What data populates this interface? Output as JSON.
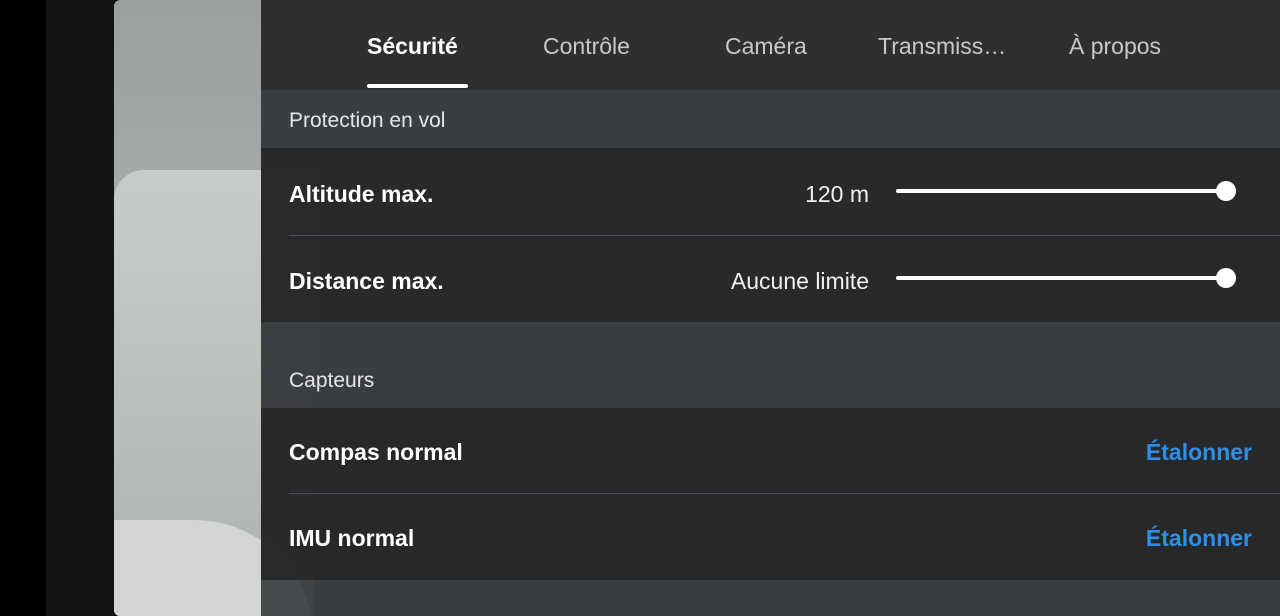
{
  "tabs": [
    {
      "label": "Sécurité",
      "active": true
    },
    {
      "label": "Contrôle",
      "active": false
    },
    {
      "label": "Caméra",
      "active": false
    },
    {
      "label": "Transmiss…",
      "active": false
    },
    {
      "label": "À propos",
      "active": false
    }
  ],
  "flight_protection": {
    "title": "Protection en vol",
    "altitude": {
      "label": "Altitude max.",
      "value": "120 m",
      "slider_fraction": 1.0
    },
    "distance": {
      "label": "Distance max.",
      "value": "Aucune limite",
      "slider_fraction": 1.0
    }
  },
  "sensors": {
    "title": "Capteurs",
    "compass": {
      "label": "Compas normal",
      "action": "Étalonner"
    },
    "imu": {
      "label": "IMU normal",
      "action": "Étalonner"
    }
  },
  "colors": {
    "accent": "#2f8fe8",
    "active_tab": "#ffffff"
  }
}
